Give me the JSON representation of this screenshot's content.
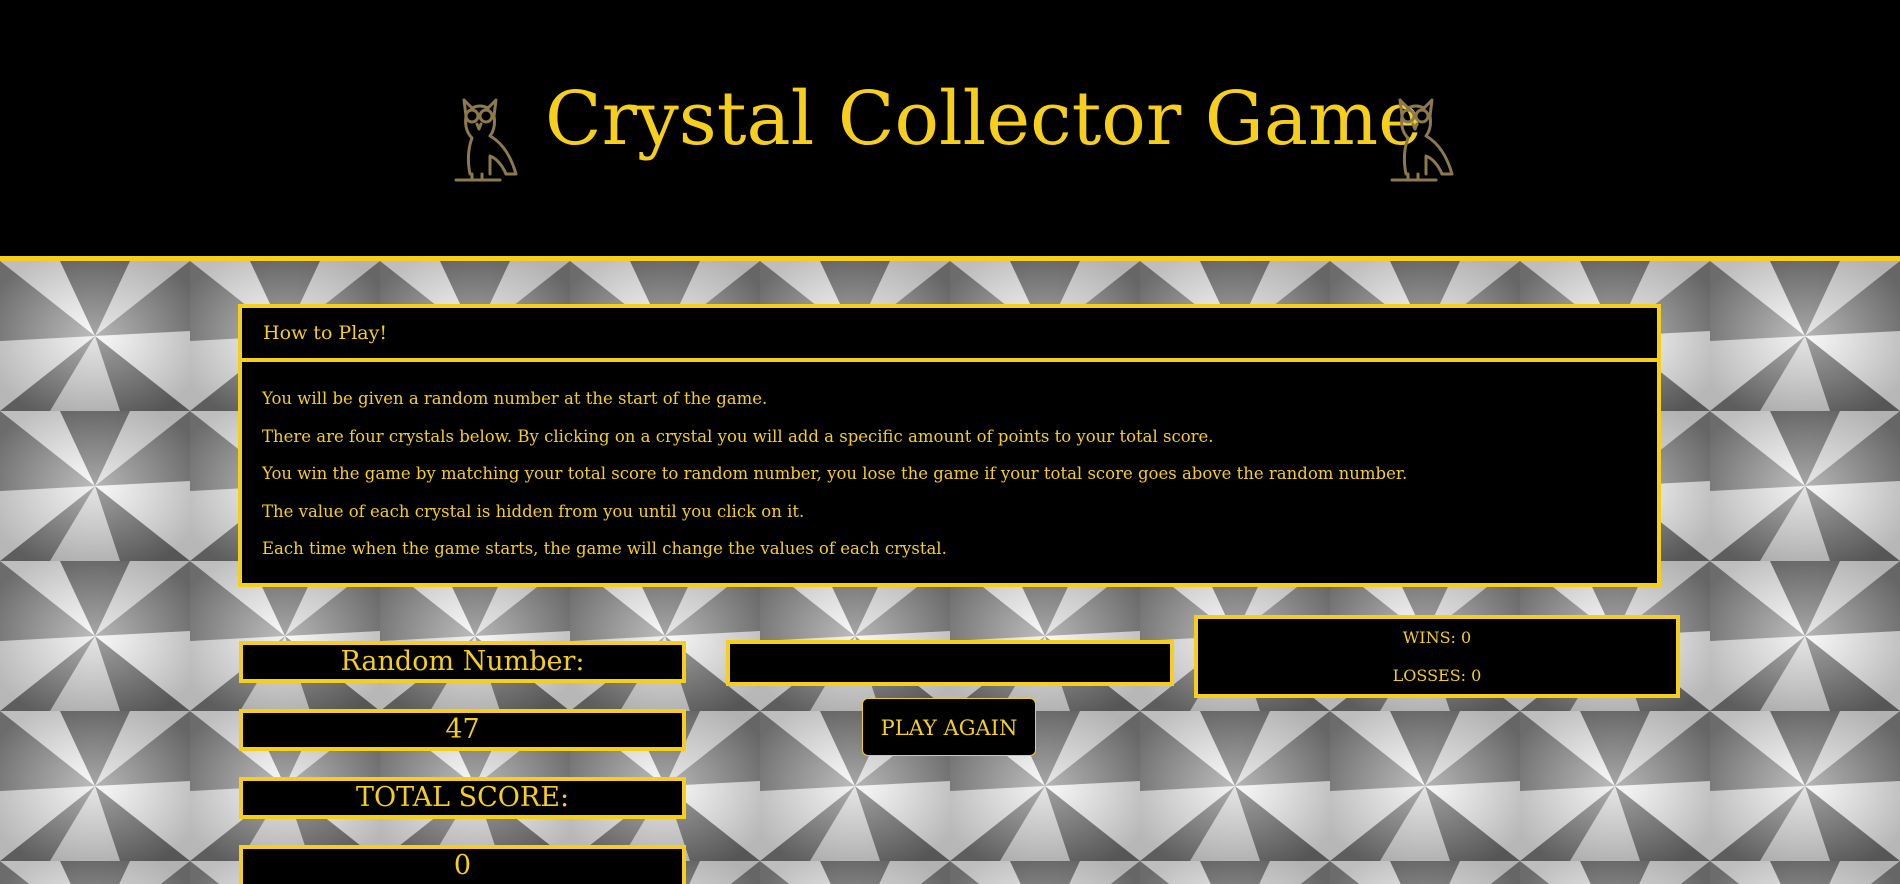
{
  "header": {
    "title": "Crystal Collector Game"
  },
  "howto": {
    "heading": "How to Play!",
    "lines": [
      "You will be given a random number at the start of the game.",
      "There are four crystals below. By clicking on a crystal you will add a specific amount of points to your total score.",
      "You win the game by matching your total score to random number, you lose the game if your total score goes above the random number.",
      "The value of each crystal is hidden from you until you click on it.",
      "Each time when the game starts, the game will change the values of each crystal."
    ]
  },
  "game": {
    "random_label": "Random Number:",
    "random_value": "47",
    "total_label": "TOTAL SCORE:",
    "total_value": "0",
    "message": "",
    "play_again": "PLAY AGAIN",
    "wins": "WINS: 0",
    "losses": "LOSSES: 0"
  },
  "colors": {
    "accent": "#f5cf1c",
    "panel": "#000000",
    "owl": "#8c7a4e"
  },
  "icons": {
    "owl": "owl-icon"
  }
}
